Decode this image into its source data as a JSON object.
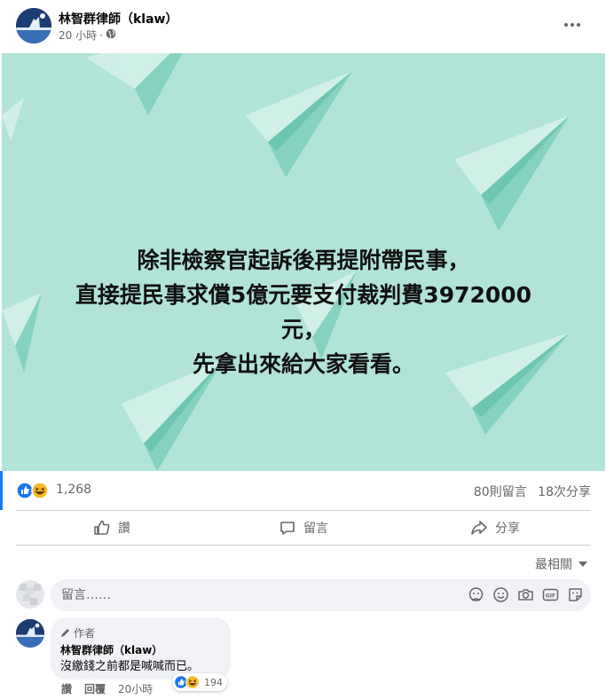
{
  "post": {
    "author": "林智群律師（klaw）",
    "time": "20 小時",
    "privacy_icon": "globe-icon",
    "more_icon": "more-dots-icon"
  },
  "card": {
    "background": "#b1e3d8",
    "lines": [
      "除非檢察官起訴後再提附帶民事，",
      "直接提民事求償5億元要支付裁判費3972000",
      "元，",
      "先拿出來給大家看看。"
    ]
  },
  "stats": {
    "reactions": [
      "like",
      "haha"
    ],
    "reaction_count": "1,268",
    "comments": "80則留言",
    "shares": "18次分享"
  },
  "actions": {
    "like": "讚",
    "comment": "留言",
    "share": "分享"
  },
  "sort": {
    "label": "最相關"
  },
  "compose": {
    "placeholder": "留言……",
    "icons": [
      "sticker-icon",
      "emoji-icon",
      "camera-icon",
      "gif-icon",
      "sticker-face-icon"
    ]
  },
  "comment": {
    "badge": "作者",
    "author": "林智群律師（klaw）",
    "text": "沒繳錢之前都是喊喊而已。",
    "reaction_count": "194",
    "like": "讚",
    "reply": "回覆",
    "time": "20小時"
  },
  "colors": {
    "accent": "#1877f2",
    "muted": "#65676b",
    "card": "#b1e3d8"
  }
}
